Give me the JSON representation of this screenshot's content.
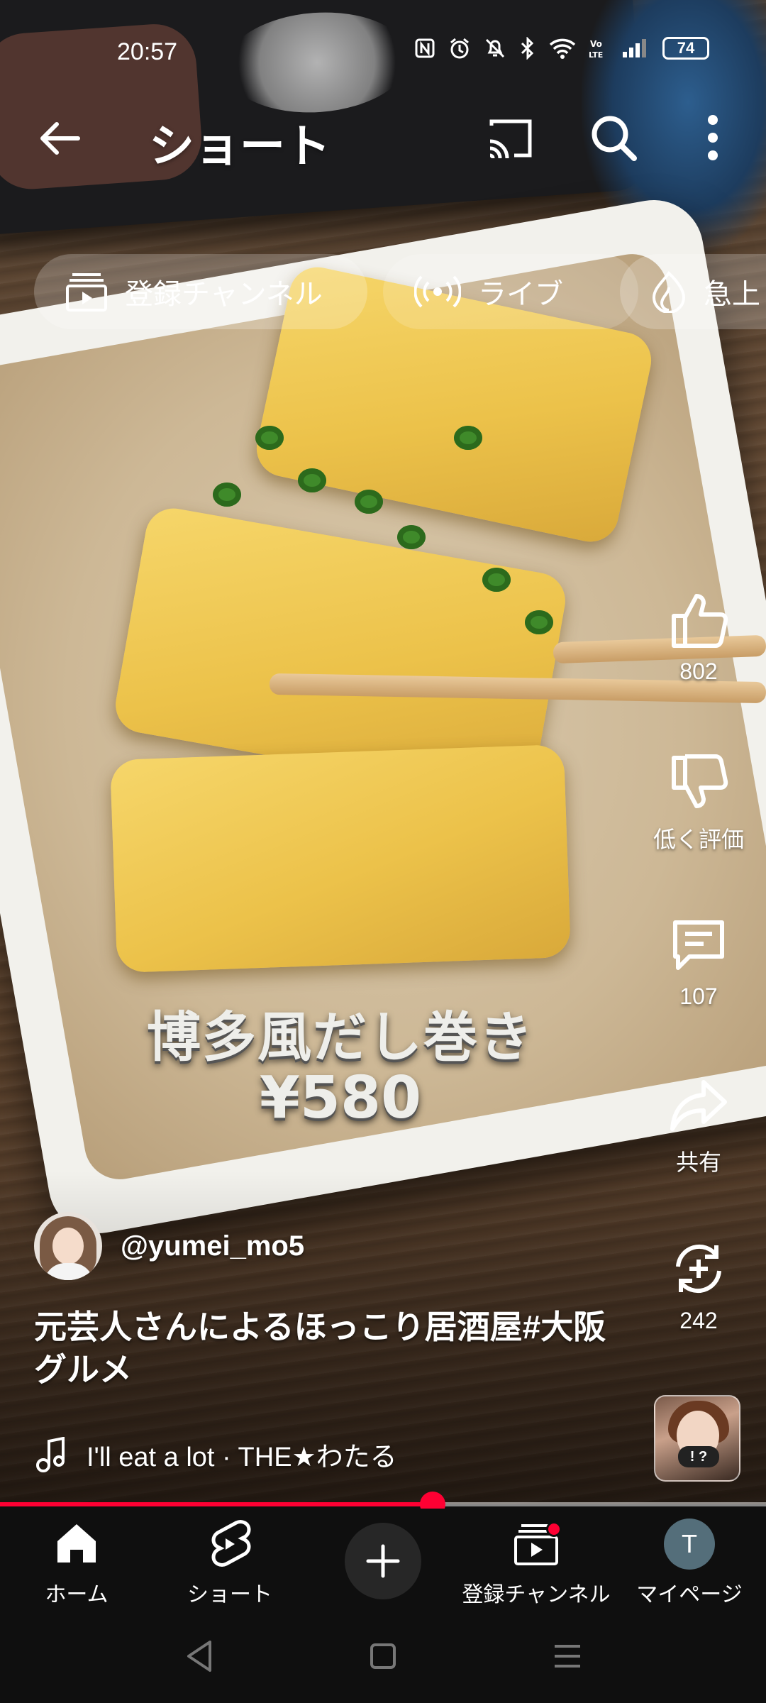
{
  "status_bar": {
    "time": "20:57",
    "battery": "74",
    "icons": [
      "nfc-icon",
      "alarm-icon",
      "mute-icon",
      "bluetooth-icon",
      "wifi-icon",
      "volte-icon",
      "signal-icon"
    ]
  },
  "app_bar": {
    "title": "ショート",
    "icons": [
      "back-arrow-icon",
      "cast-icon",
      "search-icon",
      "more-vert-icon"
    ]
  },
  "chips": [
    {
      "label": "登録チャンネル",
      "icon": "subscriptions-icon"
    },
    {
      "label": "ライブ",
      "icon": "live-icon"
    },
    {
      "label": "急上",
      "icon": "trending-icon"
    }
  ],
  "video": {
    "overlay_line1": "博多風だし巻き",
    "overlay_line2": "¥580",
    "channel_handle": "@yumei_mo5",
    "caption": "元芸人さんによるほっこり居酒屋#大阪グルメ",
    "music": "I'll eat a lot · THE★わたる",
    "progress_fraction": 0.565
  },
  "actions": {
    "like_count": "802",
    "dislike_label": "低く評価",
    "comment_count": "107",
    "share_label": "共有",
    "remix_count": "242"
  },
  "bottom_nav": {
    "home": "ホーム",
    "shorts": "ショート",
    "subscriptions": "登録チャンネル",
    "my_page": "マイページ",
    "avatar_letter": "T"
  },
  "colors": {
    "accent_red": "#ff0033",
    "nav_background": "#0f0f0f",
    "avatar_bg": "#546e7a"
  }
}
